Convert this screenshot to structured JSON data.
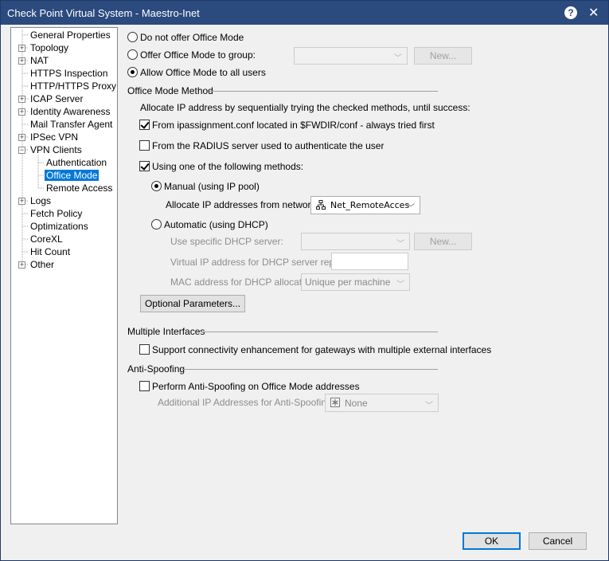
{
  "window": {
    "title": "Check Point Virtual System - Maestro-Inet"
  },
  "tree": [
    {
      "label": "General Properties"
    },
    {
      "label": "Topology"
    },
    {
      "label": "NAT"
    },
    {
      "label": "HTTPS Inspection"
    },
    {
      "label": "HTTP/HTTPS Proxy"
    },
    {
      "label": "ICAP Server"
    },
    {
      "label": "Identity Awareness"
    },
    {
      "label": "Mail Transfer Agent"
    },
    {
      "label": "IPSec VPN"
    },
    {
      "label": "VPN Clients"
    },
    {
      "label": "Authentication"
    },
    {
      "label": "Office Mode"
    },
    {
      "label": "Remote Access"
    },
    {
      "label": "Logs"
    },
    {
      "label": "Fetch Policy"
    },
    {
      "label": "Optimizations"
    },
    {
      "label": "CoreXL"
    },
    {
      "label": "Hit Count"
    },
    {
      "label": "Other"
    }
  ],
  "offer": {
    "no_offer": "Do not offer Office Mode",
    "to_group": "Offer Office Mode to group:",
    "all_users": "Allow Office Mode to all users",
    "new_button": "New..."
  },
  "method": {
    "header": "Office Mode Method",
    "description": "Allocate IP address by sequentially trying the checked methods, until success:",
    "ipassignment": "From ipassignment.conf located in $FWDIR/conf - always tried first",
    "radius": "From the RADIUS server used to authenticate the user",
    "following": "Using one of the following methods:",
    "manual": "Manual (using IP pool)",
    "allocate_label": "Allocate IP addresses from network:",
    "network_value": "Net_RemoteAcces",
    "automatic": "Automatic (using DHCP)",
    "dhcp_server_label": "Use specific DHCP server:",
    "dhcp_new_button": "New...",
    "virtual_ip_label": "Virtual IP address for DHCP server replies:",
    "mac_label": "MAC address for DHCP allocation:",
    "mac_value": "Unique per machine",
    "optional_button": "Optional Parameters..."
  },
  "multi": {
    "header": "Multiple Interfaces",
    "support": "Support connectivity enhancement for gateways with multiple external interfaces"
  },
  "anti": {
    "header": "Anti-Spoofing",
    "perform": "Perform Anti-Spoofing on Office Mode addresses",
    "additional_label": "Additional IP Addresses for Anti-Spoofing:",
    "none_value": "None"
  },
  "footer": {
    "ok": "OK",
    "cancel": "Cancel"
  }
}
